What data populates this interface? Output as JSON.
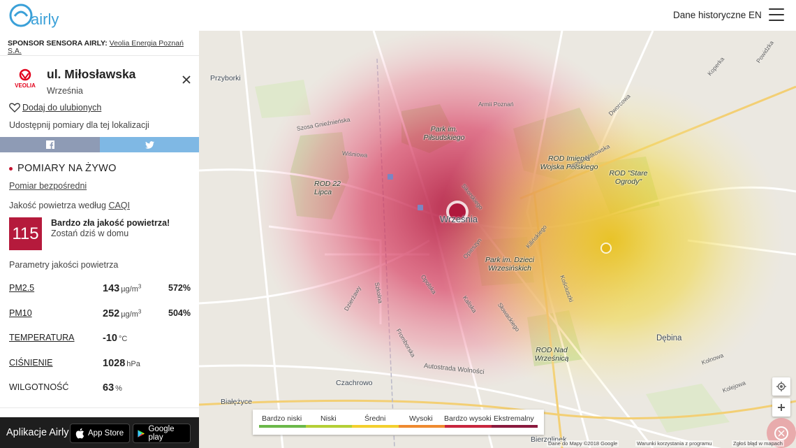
{
  "header": {
    "logo_text": "airly",
    "historical_link": "Dane historyczne",
    "language": "EN",
    "menu_icon": "hamburger-icon"
  },
  "sponsor": {
    "label": "SPONSOR SENSORA AIRLY:",
    "name": "Veolia Energia Poznań S.A."
  },
  "station": {
    "brand_logo_text": "VEOLIA",
    "name": "ul. Miłosławska",
    "city": "Września",
    "close_icon": "close-icon",
    "favorite_label": "Dodaj do ulubionych",
    "share_label": "Udostępnij pomiary dla tej lokalizacji"
  },
  "live": {
    "title": "POMIARY NA ŻYWO",
    "direct_link": "Pomiar bezpośredni",
    "caqi_prefix": "Jakość powietrza według ",
    "caqi_link": "CAQI",
    "caqi_value": "115",
    "caqi_color": "#b51a3c",
    "caqi_title": "Bardzo zła jakość powietrza!",
    "caqi_advice": "Zostań dziś w domu",
    "params_title": "Parametry jakości powietrza"
  },
  "parameters": [
    {
      "name": "PM2.5",
      "value": "143",
      "unit": "µg/m",
      "sup": "3",
      "percent": "572%",
      "link": true
    },
    {
      "name": "PM10",
      "value": "252",
      "unit": "µg/m",
      "sup": "3",
      "percent": "504%",
      "link": true
    },
    {
      "name": "TEMPERATURA",
      "value": "-10",
      "unit": "°C",
      "sup": "",
      "percent": "",
      "link": true
    },
    {
      "name": "CIŚNIENIE",
      "value": "1028",
      "unit": "hPa",
      "sup": "",
      "percent": "",
      "link": true
    },
    {
      "name": "WILGOTNOŚĆ",
      "value": "63",
      "unit": "%",
      "sup": "",
      "percent": "",
      "link": false
    }
  ],
  "apps": {
    "label": "Aplikacje Airly",
    "app_store": "App Store",
    "google_play": "Google play"
  },
  "map": {
    "labels": [
      "Przyborki",
      "Koperka",
      "Powidzka",
      "Armii Poznań",
      "Park im. Piłsudskiego",
      "ROD Imienia Wojska Polskiego",
      "ROD 22 Lipca",
      "ROD \"Stare Ogrody\"",
      "Września",
      "Park im. Dzieci Wrzesińskich",
      "Dębina",
      "ROD Nad Wrześnicą",
      "Autostrada Wolności",
      "Białężyce",
      "Czachrowo",
      "Bierzglinek",
      "Sikorskiego",
      "szosa Witkowska",
      "Wiśniowa",
      "Kilińskiego",
      "Opieszyn",
      "Kościuszki",
      "Fromborska",
      "Dzierżawy",
      "Kolejowa",
      "Słowackiego",
      "Dworcowa",
      "Opolska",
      "Kaliska",
      "Kolnowa",
      "Szosa Gnieźnieńska",
      "Szkolna"
    ],
    "legend": [
      "Bardzo niski",
      "Niski",
      "Średni",
      "Wysoki",
      "Bardzo wysoki",
      "Ekstremalny"
    ],
    "legend_colors": [
      "#6bb84a",
      "#b4cf36",
      "#f3d02e",
      "#ef8a30",
      "#c8253d",
      "#8a1a3e"
    ],
    "attribution": {
      "data": "Dane do Mapy ©2018 Google",
      "terms": "Warunki korzystania z programu",
      "report": "Zgłoś błąd w mapach"
    }
  }
}
